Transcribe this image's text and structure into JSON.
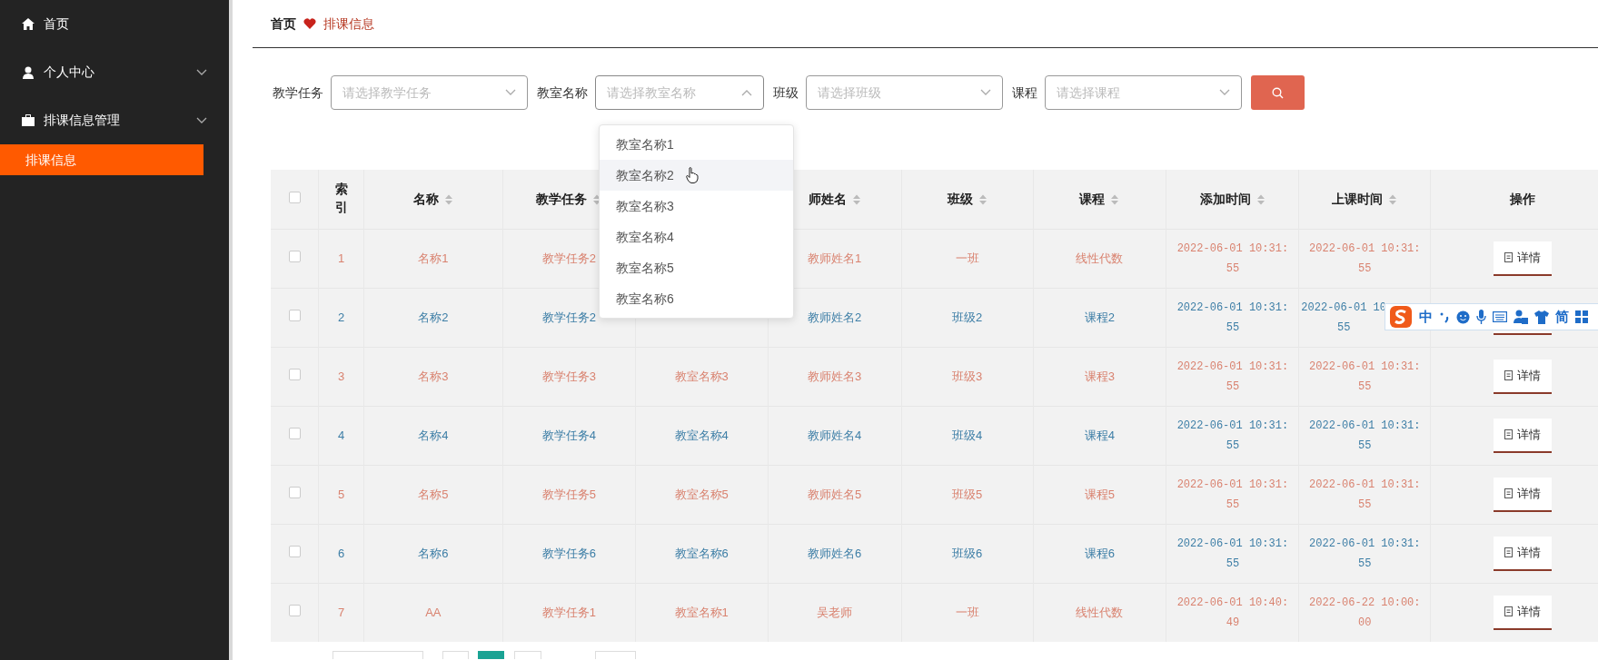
{
  "sidebar": {
    "items": [
      {
        "label": "首页",
        "has_submenu": false
      },
      {
        "label": "个人中心",
        "has_submenu": true
      },
      {
        "label": "排课信息管理",
        "has_submenu": true,
        "children": [
          {
            "label": "排课信息",
            "selected": true
          }
        ]
      }
    ]
  },
  "breadcrumb": [
    "首页",
    "排课信息"
  ],
  "filters": [
    {
      "label": "教学任务",
      "placeholder": "请选择教学任务",
      "open": false
    },
    {
      "label": "教室名称",
      "placeholder": "请选择教室名称",
      "open": true
    },
    {
      "label": "班级",
      "placeholder": "请选择班级",
      "open": false
    },
    {
      "label": "课程",
      "placeholder": "请选择课程",
      "open": false
    }
  ],
  "dropdown": {
    "options": [
      {
        "label": "教室名称1",
        "hovered": false
      },
      {
        "label": "教室名称2",
        "hovered": true
      },
      {
        "label": "教室名称3",
        "hovered": false
      },
      {
        "label": "教室名称4",
        "hovered": false
      },
      {
        "label": "教室名称5",
        "hovered": false
      },
      {
        "label": "教室名称6",
        "hovered": false
      }
    ]
  },
  "table": {
    "select_all_checked": false,
    "columns": [
      {
        "label": "索引",
        "kind": "plain"
      },
      {
        "label": "名称",
        "kind": "sort"
      },
      {
        "label": "教学任务",
        "kind": "sort"
      },
      null,
      {
        "label": "师姓名",
        "kind": "sort"
      },
      {
        "label": "班级",
        "kind": "sort"
      },
      {
        "label": "课程",
        "kind": "sort"
      },
      {
        "label": "添加时间",
        "kind": "sort"
      },
      {
        "label": "上课时间",
        "kind": "sort"
      },
      {
        "label": "操作",
        "kind": "plain"
      }
    ],
    "rows": [
      {
        "checked": false,
        "color": "#d9826f",
        "cells": [
          "1",
          "名称1",
          "教学任务2",
          null,
          "教师姓名1",
          "一班",
          "线性代数",
          "2022-06-01 10:31:55",
          "2022-06-01 10:31:55"
        ],
        "action": "详情"
      },
      {
        "checked": false,
        "color": "#3d7ea6",
        "cells": [
          "2",
          "名称2",
          "教学任务2",
          null,
          "教师姓名2",
          "班级2",
          "课程2",
          "2022-06-01 10:31:55",
          "2022-06-01 10\n55"
        ]
      },
      {
        "checked": false,
        "color": "#d9826f",
        "cells": [
          "3",
          "名称3",
          "教学任务3",
          "教室名称3",
          "教师姓名3",
          "班级3",
          "课程3",
          "2022-06-01 10:31:55",
          "2022-06-01 10:31:55"
        ],
        "action": "详情"
      },
      {
        "checked": false,
        "color": "#3d7ea6",
        "cells": [
          "4",
          "名称4",
          "教学任务4",
          "教室名称4",
          "教师姓名4",
          "班级4",
          "课程4",
          "2022-06-01 10:31:55",
          "2022-06-01 10:31:55"
        ],
        "action": "详情"
      },
      {
        "checked": false,
        "color": "#d9826f",
        "cells": [
          "5",
          "名称5",
          "教学任务5",
          "教室名称5",
          "教师姓名5",
          "班级5",
          "课程5",
          "2022-06-01 10:31:55",
          "2022-06-01 10:31:55"
        ],
        "action": "详情"
      },
      {
        "checked": false,
        "color": "#3d7ea6",
        "cells": [
          "6",
          "名称6",
          "教学任务6",
          "教室名称6",
          "教师姓名6",
          "班级6",
          "课程6",
          "2022-06-01 10:31:55",
          "2022-06-01 10:31:55"
        ],
        "action": "详情"
      },
      {
        "checked": false,
        "color": "#d9826f",
        "cells": [
          "7",
          "AA",
          "教学任务1",
          "教室名称1",
          "吴老师",
          "一班",
          "线性代数",
          "2022-06-01 10:40:49",
          "2022-06-22 10:00:00"
        ],
        "action": "详情"
      }
    ]
  },
  "ime_toolbar": {
    "mode": "中",
    "script": "简"
  }
}
